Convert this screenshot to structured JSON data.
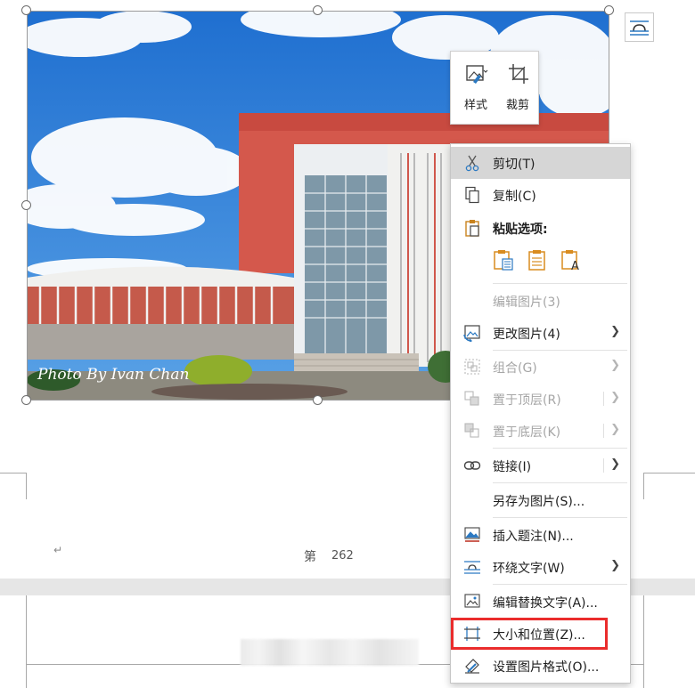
{
  "photo": {
    "watermark_text": "Photo By Ivan Chan"
  },
  "mini_toolbar": {
    "style_label": "样式",
    "crop_label": "裁剪"
  },
  "page": {
    "page_label": "第",
    "page_number": "262"
  },
  "context_menu": {
    "items": [
      {
        "label": "剪切(T)",
        "icon": "scissors-icon",
        "enabled": true,
        "highlighted": true
      },
      {
        "label": "复制(C)",
        "icon": "copy-icon",
        "enabled": true
      },
      {
        "label": "粘贴选项:",
        "icon": "paste-icon",
        "enabled": true
      },
      {
        "label": "编辑图片(3)",
        "icon": "",
        "enabled": false
      },
      {
        "label": "更改图片(4)",
        "icon": "change-picture-icon",
        "enabled": true,
        "submenu": true
      },
      {
        "label": "组合(G)",
        "icon": "group-icon",
        "enabled": false,
        "submenu": true
      },
      {
        "label": "置于顶层(R)",
        "icon": "bring-to-front-icon",
        "enabled": false,
        "submenu": true
      },
      {
        "label": "置于底层(K)",
        "icon": "send-to-back-icon",
        "enabled": false,
        "submenu": true
      },
      {
        "label": "链接(I)",
        "icon": "link-icon",
        "enabled": true,
        "submenu": true
      },
      {
        "label": "另存为图片(S)...",
        "icon": "",
        "enabled": true
      },
      {
        "label": "插入题注(N)...",
        "icon": "insert-caption-icon",
        "enabled": true
      },
      {
        "label": "环绕文字(W)",
        "icon": "wrap-text-icon",
        "enabled": true,
        "submenu": true
      },
      {
        "label": "编辑替换文字(A)...",
        "icon": "alt-text-icon",
        "enabled": true
      },
      {
        "label": "大小和位置(Z)...",
        "icon": "size-position-icon",
        "enabled": true
      },
      {
        "label": "设置图片格式(O)...",
        "icon": "format-picture-icon",
        "enabled": true
      }
    ],
    "paste_options": [
      "paste-keep-formatting-icon",
      "paste-picture-icon",
      "paste-text-only-icon"
    ]
  },
  "colors": {
    "accent": "#2b79c2",
    "highlight_box": "#ea2c2c",
    "menu_hover": "#d6d6d6"
  }
}
